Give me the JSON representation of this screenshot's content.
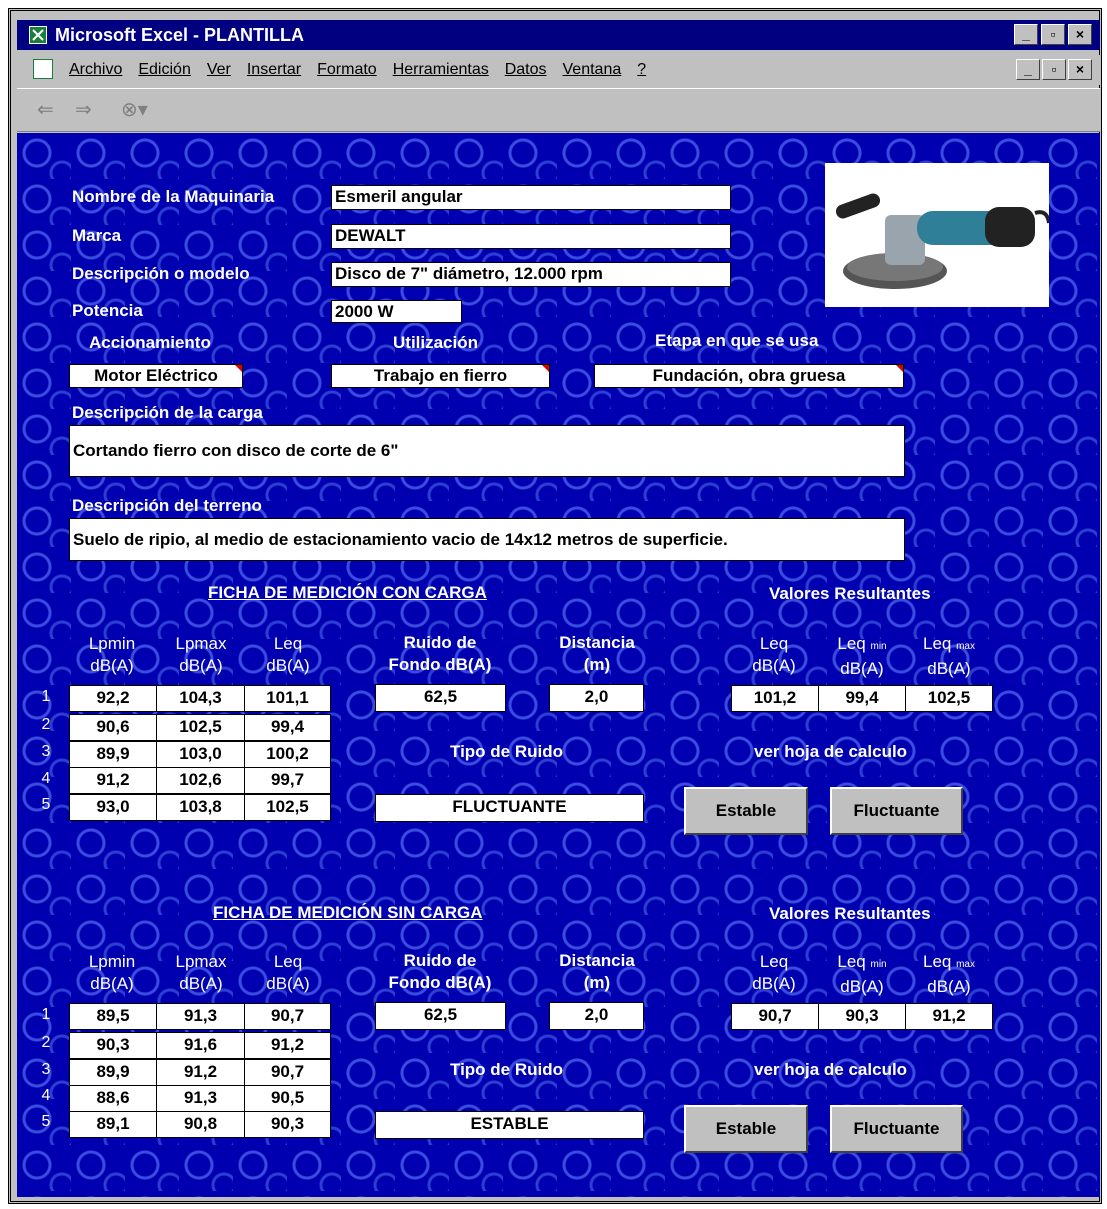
{
  "window": {
    "title": "Microsoft Excel - PLANTILLA"
  },
  "menu": [
    {
      "label": "Archivo"
    },
    {
      "label": "Edición"
    },
    {
      "label": "Ver"
    },
    {
      "label": "Insertar"
    },
    {
      "label": "Formato"
    },
    {
      "label": "Herramientas"
    },
    {
      "label": "Datos"
    },
    {
      "label": "Ventana"
    },
    {
      "label": "?"
    }
  ],
  "toolbar": {
    "icons": [
      "back-arrow-icon",
      "forward-arrow-icon",
      "stop-icon"
    ]
  },
  "form": {
    "machine_label": "Nombre de la Maquinaria",
    "machine_value": "Esmeril angular",
    "brand_label": "Marca",
    "brand_value": "DEWALT",
    "model_label": "Descripción o modelo",
    "model_value": "Disco de 7\" diámetro, 12.000 rpm",
    "power_label": "Potencia",
    "power_value": "2000 W",
    "drive_label": "Accionamiento",
    "drive_value": "Motor Eléctrico",
    "use_label": "Utilización",
    "use_value": "Trabajo en fierro",
    "stage_label": "Etapa en que se usa",
    "stage_value": "Fundación, obra gruesa",
    "load_label": "Descripción de la carga",
    "load_value": "Cortando fierro con disco de corte de 6\"",
    "terrain_label": "Descripción del terreno",
    "terrain_value": "Suelo de ripio, al medio de estacionamiento vacio de 14x12 metros de superficie."
  },
  "headers": {
    "lpmin": "Lpmin",
    "lpmax": "Lpmax",
    "leq": "Leq",
    "unit": "dB(A)",
    "noise_bg_1": "Ruido de",
    "noise_bg_2": "Fondo dB(A)",
    "distance_1": "Distancia",
    "distance_2": "(m)",
    "leq_min": "Leq",
    "leq_min_sub": "min",
    "leq_max": "Leq",
    "leq_max_sub": "max",
    "results": "Valores Resultantes",
    "noise_type": "Tipo de Ruido",
    "see_sheet": "ver hoja de calculo"
  },
  "with_load": {
    "title": "FICHA DE MEDICIÓN CON CARGA",
    "rows": [
      {
        "n": "1",
        "lpmin": "92,2",
        "lpmax": "104,3",
        "leq": "101,1"
      },
      {
        "n": "2",
        "lpmin": "90,6",
        "lpmax": "102,5",
        "leq": "99,4"
      },
      {
        "n": "3",
        "lpmin": "89,9",
        "lpmax": "103,0",
        "leq": "100,2"
      },
      {
        "n": "4",
        "lpmin": "91,2",
        "lpmax": "102,6",
        "leq": "99,7"
      },
      {
        "n": "5",
        "lpmin": "93,0",
        "lpmax": "103,8",
        "leq": "102,5"
      }
    ],
    "background_noise": "62,5",
    "distance": "2,0",
    "result_leq": "101,2",
    "result_leq_min": "99,4",
    "result_leq_max": "102,5",
    "noise_type_value": "FLUCTUANTE",
    "btn_stable": "Estable",
    "btn_fluct": "Fluctuante"
  },
  "without_load": {
    "title": "FICHA DE MEDICIÓN SIN CARGA",
    "rows": [
      {
        "n": "1",
        "lpmin": "89,5",
        "lpmax": "91,3",
        "leq": "90,7"
      },
      {
        "n": "2",
        "lpmin": "90,3",
        "lpmax": "91,6",
        "leq": "91,2"
      },
      {
        "n": "3",
        "lpmin": "89,9",
        "lpmax": "91,2",
        "leq": "90,7"
      },
      {
        "n": "4",
        "lpmin": "88,6",
        "lpmax": "91,3",
        "leq": "90,5"
      },
      {
        "n": "5",
        "lpmin": "89,1",
        "lpmax": "90,8",
        "leq": "90,3"
      }
    ],
    "background_noise": "62,5",
    "distance": "2,0",
    "result_leq": "90,7",
    "result_leq_min": "90,3",
    "result_leq_max": "91,2",
    "noise_type_value": "ESTABLE",
    "btn_stable": "Estable",
    "btn_fluct": "Fluctuante"
  },
  "colors": {
    "sheet_bg": "#0000b0",
    "titlebar": "#000080",
    "chrome": "#c0c0c0"
  }
}
